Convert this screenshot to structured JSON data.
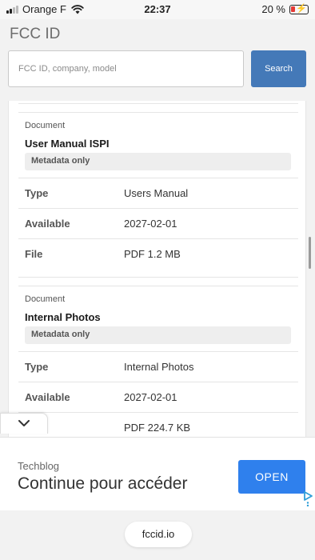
{
  "status_bar": {
    "carrier": "Orange F",
    "time": "22:37",
    "battery": "20 %",
    "battery_color": "#e53935"
  },
  "header": {
    "brand": "FCC ID",
    "search": {
      "placeholder": "FCC ID, company, model",
      "value": "",
      "button_label": "Search"
    },
    "accent_color": "#4479b8"
  },
  "documents": [
    {
      "label": "Document",
      "title": "User Manual ISPI",
      "badge": "Metadata only",
      "rows": [
        {
          "key": "Type",
          "value": "Users Manual"
        },
        {
          "key": "Available",
          "value": "2027-02-01"
        },
        {
          "key": "File",
          "value": "PDF 1.2 MB"
        }
      ]
    },
    {
      "label": "Document",
      "title": "Internal Photos",
      "badge": "Metadata only",
      "rows": [
        {
          "key": "Type",
          "value": "Internal Photos"
        },
        {
          "key": "Available",
          "value": "2027-02-01"
        },
        {
          "key": "File",
          "value": "PDF 224.7 KB"
        }
      ]
    }
  ],
  "collapse_icon": "chevron-down-icon",
  "ad": {
    "source": "Techblog",
    "headline": "Continue pour accéder",
    "button_label": "OPEN",
    "button_color": "#2f80ed",
    "choices_icon": "adchoices-icon"
  },
  "browser": {
    "url": "fccid.io"
  }
}
